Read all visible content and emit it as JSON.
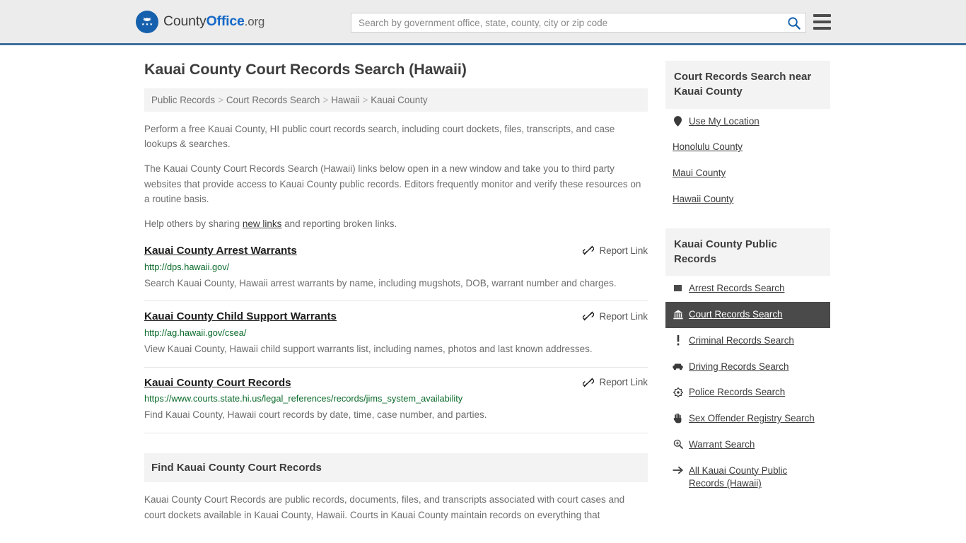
{
  "header": {
    "brand": {
      "part1": "County",
      "part2": "Office",
      "part3": ".org",
      "icon": "eagle-seal-icon"
    },
    "search": {
      "placeholder": "Search by government office, state, county, city or zip code",
      "value": "",
      "icon": "search-icon"
    },
    "menu": {
      "icon": "hamburger-menu-icon"
    }
  },
  "main": {
    "title": "Kauai County Court Records Search (Hawaii)",
    "breadcrumb": [
      {
        "label": "Public Records"
      },
      {
        "label": "Court Records Search"
      },
      {
        "label": "Hawaii"
      },
      {
        "label": "Kauai County"
      }
    ],
    "breadcrumb_separator": ">",
    "intro": {
      "p1": "Perform a free Kauai County, HI public court records search, including court dockets, files, transcripts, and case lookups & searches.",
      "p2": "The Kauai County Court Records Search (Hawaii) links below open in a new window and take you to third party websites that provide access to Kauai County public records. Editors frequently monitor and verify these resources on a routine basis.",
      "p3_before": "Help others by sharing ",
      "p3_link": "new links",
      "p3_after": " and reporting broken links."
    },
    "report_link_label": "Report Link",
    "report_link_icon": "broken-chain-icon",
    "results": [
      {
        "title": "Kauai County Arrest Warrants",
        "url": "http://dps.hawaii.gov/",
        "description": "Search Kauai County, Hawaii arrest warrants by name, including mugshots, DOB, warrant number and charges."
      },
      {
        "title": "Kauai County Child Support Warrants",
        "url": "http://ag.hawaii.gov/csea/",
        "description": "View Kauai County, Hawaii child support warrants list, including names, photos and last known addresses."
      },
      {
        "title": "Kauai County Court Records",
        "url": "https://www.courts.state.hi.us/legal_references/records/jims_system_availability",
        "description": "Find Kauai County, Hawaii court records by date, time, case number, and parties."
      }
    ],
    "section": {
      "heading": "Find Kauai County Court Records",
      "body": "Kauai County Court Records are public records, documents, files, and transcripts associated with court cases and court dockets available in Kauai County, Hawaii. Courts in Kauai County maintain records on everything that"
    }
  },
  "sidebar": {
    "nearby": {
      "heading": "Court Records Search near Kauai County",
      "items": [
        {
          "label": "Use My Location",
          "icon": "map-pin-icon"
        },
        {
          "label": "Honolulu County",
          "icon": ""
        },
        {
          "label": "Maui County",
          "icon": ""
        },
        {
          "label": "Hawaii County",
          "icon": ""
        }
      ]
    },
    "public_records": {
      "heading": "Kauai County Public Records",
      "items": [
        {
          "label": "Arrest Records Search",
          "icon": "handcuffs-icon",
          "active": false
        },
        {
          "label": "Court Records Search",
          "icon": "courthouse-icon",
          "active": true
        },
        {
          "label": "Criminal Records Search",
          "icon": "exclamation-icon",
          "active": false
        },
        {
          "label": "Driving Records Search",
          "icon": "car-icon",
          "active": false
        },
        {
          "label": "Police Records Search",
          "icon": "police-badge-icon",
          "active": false
        },
        {
          "label": "Sex Offender Registry Search",
          "icon": "hand-icon",
          "active": false
        },
        {
          "label": "Warrant Search",
          "icon": "magnifier-plus-icon",
          "active": false
        },
        {
          "label": "All Kauai County Public Records (Hawaii)",
          "icon": "arrow-right-icon",
          "active": false
        }
      ]
    }
  },
  "colors": {
    "brand_blue": "#1569c7",
    "header_border": "#3d6e9e",
    "url_green": "#0a6b2a",
    "active_bg": "#4a4a4a",
    "panel_gray": "#f3f3f3"
  }
}
